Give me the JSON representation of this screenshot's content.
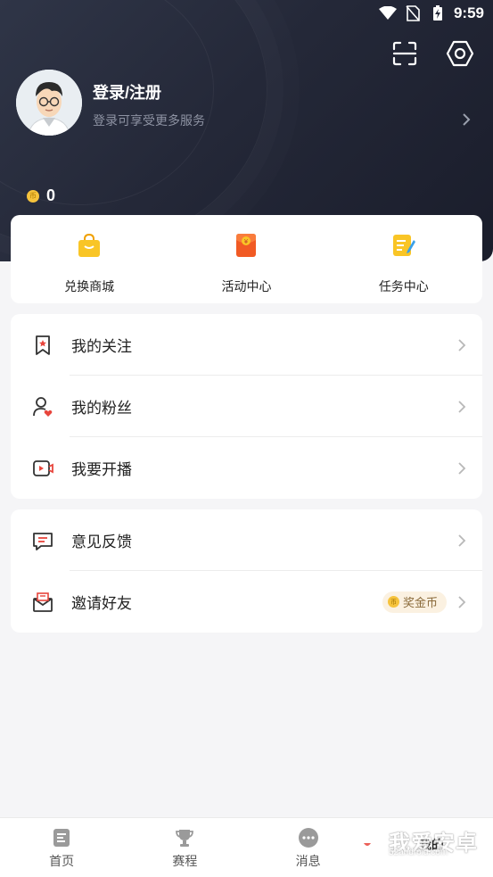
{
  "status_bar": {
    "time": "9:59"
  },
  "profile": {
    "title": "登录/注册",
    "subtitle": "登录可享受更多服务",
    "coins": "0"
  },
  "quick_actions": [
    {
      "label": "兑换商城",
      "icon": "shopping-bag-icon",
      "color": "#f7b500"
    },
    {
      "label": "活动中心",
      "icon": "red-envelope-icon",
      "color": "#f15a24"
    },
    {
      "label": "任务中心",
      "icon": "task-note-icon",
      "color": "#f9c526"
    }
  ],
  "menu_group_1": [
    {
      "label": "我的关注",
      "icon": "bookmark-star-icon"
    },
    {
      "label": "我的粉丝",
      "icon": "user-heart-icon"
    },
    {
      "label": "我要开播",
      "icon": "video-play-icon"
    }
  ],
  "menu_group_2": [
    {
      "label": "意见反馈",
      "icon": "feedback-chat-icon"
    },
    {
      "label": "邀请好友",
      "icon": "envelope-icon",
      "badge": "奖金币"
    }
  ],
  "tabbar": [
    {
      "label": "首页",
      "icon": "home-doc-icon"
    },
    {
      "label": "赛程",
      "icon": "trophy-icon"
    },
    {
      "label": "消息",
      "icon": "message-dots-icon"
    },
    {
      "label": "我的",
      "icon": "profile-icon",
      "active": true
    }
  ],
  "watermark": {
    "text": "我爱安卓",
    "sub": "52android.com"
  },
  "colors": {
    "header_bg": "#242838",
    "accent_red": "#e8453c",
    "coin": "#f6c33c",
    "background": "#f5f5f7"
  }
}
